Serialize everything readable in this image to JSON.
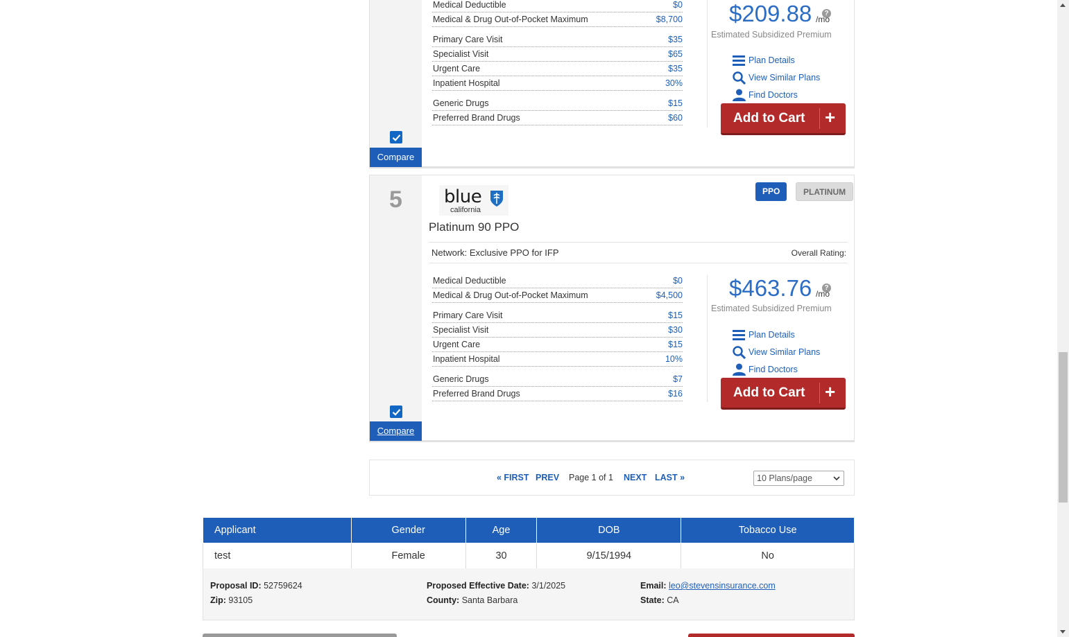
{
  "plans": [
    {
      "rank": "",
      "plan_name": "",
      "benefits_top": [
        {
          "label": "Medical Deductible",
          "value": "$0"
        },
        {
          "label": "Medical & Drug Out-of-Pocket Maximum",
          "value": "$8,700"
        }
      ],
      "benefits_mid": [
        {
          "label": "Primary Care Visit",
          "value": "$35"
        },
        {
          "label": "Specialist Visit",
          "value": "$65"
        },
        {
          "label": "Urgent Care",
          "value": "$35"
        },
        {
          "label": "Inpatient Hospital",
          "value": "30%"
        }
      ],
      "benefits_bot": [
        {
          "label": "Generic Drugs",
          "value": "$15"
        },
        {
          "label": "Preferred Brand Drugs",
          "value": "$60"
        }
      ],
      "price": "$209.88",
      "per": "/mo",
      "premium_label": "Estimated Subsidized Premium",
      "links": {
        "details": "Plan Details",
        "similar": "View Similar Plans",
        "doctors": "Find Doctors"
      },
      "cart_label": "Add to Cart",
      "compare_label": "Compare",
      "compare_checked": true
    },
    {
      "rank": "5",
      "network_type": "PPO",
      "metal_tier": "PLATINUM",
      "carrier_logo": {
        "word": "blue",
        "sub": "california"
      },
      "plan_name": "Platinum 90 PPO",
      "network": "Network: Exclusive PPO for IFP",
      "rating_label": "Overall Rating:",
      "benefits_top": [
        {
          "label": "Medical Deductible",
          "value": "$0"
        },
        {
          "label": "Medical & Drug Out-of-Pocket Maximum",
          "value": "$4,500"
        }
      ],
      "benefits_mid": [
        {
          "label": "Primary Care Visit",
          "value": "$15"
        },
        {
          "label": "Specialist Visit",
          "value": "$30"
        },
        {
          "label": "Urgent Care",
          "value": "$15"
        },
        {
          "label": "Inpatient Hospital",
          "value": "10%"
        }
      ],
      "benefits_bot": [
        {
          "label": "Generic Drugs",
          "value": "$7"
        },
        {
          "label": "Preferred Brand Drugs",
          "value": "$16"
        }
      ],
      "price": "$463.76",
      "per": "/mo",
      "premium_label": "Estimated Subsidized Premium",
      "links": {
        "details": "Plan Details",
        "similar": "View Similar Plans",
        "doctors": "Find Doctors"
      },
      "cart_label": "Add to Cart",
      "compare_label": "Compare",
      "compare_checked": true
    }
  ],
  "pager": {
    "first": "« FIRST",
    "prev": "PREV",
    "info": "Page 1 of 1",
    "next": "NEXT",
    "last": "LAST »",
    "per_page": "10 Plans/page"
  },
  "applicants": {
    "headers": [
      "Applicant",
      "Gender",
      "Age",
      "DOB",
      "Tobacco Use"
    ],
    "rows": [
      [
        "test",
        "Female",
        "30",
        "9/15/1994",
        "No"
      ]
    ]
  },
  "proposal": {
    "id_label": "Proposal ID:",
    "id": "52759624",
    "zip_label": "Zip:",
    "zip": "93105",
    "date_label": "Proposed Effective Date:",
    "date": "3/1/2025",
    "county_label": "County:",
    "county": "Santa Barbara",
    "email_label": "Email:",
    "email": "leo@stevensinsurance.com",
    "state_label": "State:",
    "state": "CA"
  },
  "colors": {
    "primary": "#1e5eb8",
    "cart": "#b22a2a",
    "price": "#2b6cc4"
  },
  "icons": [
    "list-icon",
    "search-icon",
    "user-icon",
    "plus-icon",
    "checkbox-checked-icon",
    "help-icon",
    "chevron-down-icon",
    "shield-icon"
  ]
}
